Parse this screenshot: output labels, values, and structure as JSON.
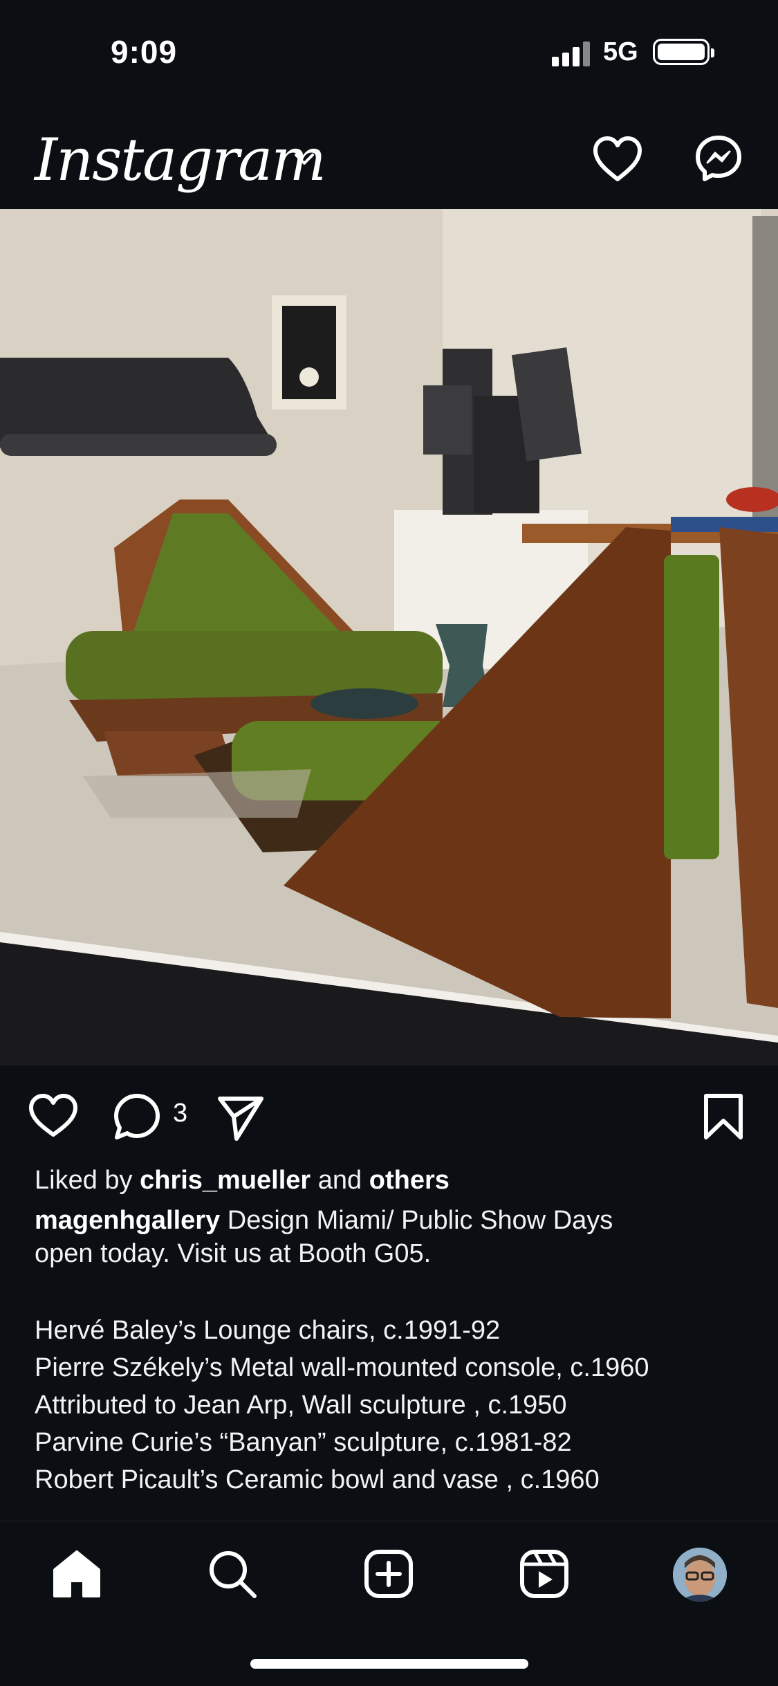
{
  "status_bar": {
    "time": "9:09",
    "network": "5G"
  },
  "header": {
    "app_title": "Instagram"
  },
  "post": {
    "comment_count": "3",
    "liked_by_prefix": "Liked by ",
    "liked_by_user": "chris_mueller",
    "liked_by_and": " and ",
    "liked_by_others": "others",
    "author": "magenhgallery",
    "caption_first_a": " Design Miami/ Public Show Days",
    "caption_first_b": "open today. Visit us at Booth G05.",
    "caption_lines": [
      "Hervé Baley’s Lounge chairs, c.1991-92",
      "Pierre Székely’s Metal wall-mounted console, c.1960",
      "Attributed to Jean Arp, Wall sculpture , c.1950",
      "Parvine Curie’s “Banyan” sculpture, c.1981-82",
      "Robert Picault’s Ceramic bowl and vase , c.1960"
    ]
  },
  "icons": {
    "header": [
      "chevron-down-icon",
      "heart-icon",
      "messenger-icon"
    ],
    "actions": [
      "heart-icon",
      "comment-icon",
      "share-icon",
      "bookmark-icon"
    ],
    "nav": [
      "home-icon",
      "search-icon",
      "create-icon",
      "reels-icon",
      "profile-avatar"
    ]
  },
  "colors": {
    "background": "#0b0e13",
    "text": "#ffffff"
  }
}
